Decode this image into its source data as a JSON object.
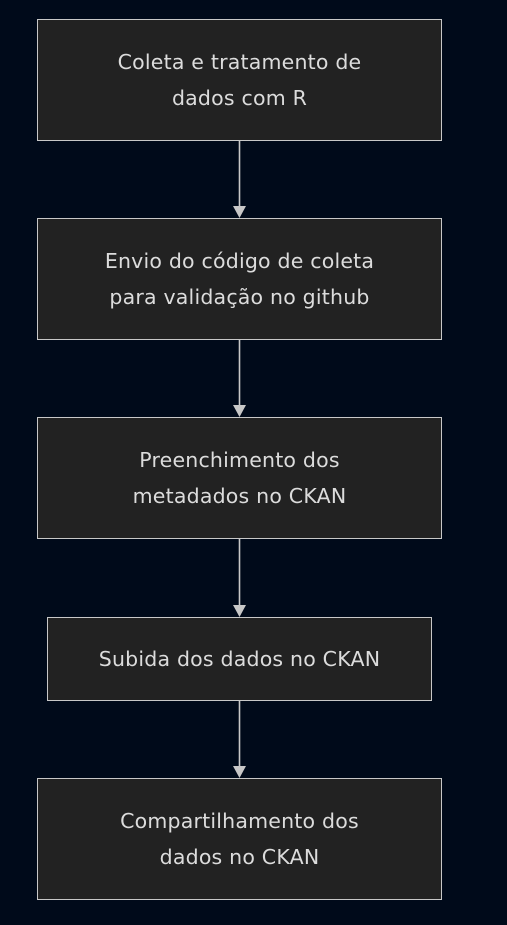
{
  "flowchart": {
    "nodes": [
      {
        "id": "n1",
        "lines": [
          "Coleta e tratamento de",
          "dados com R"
        ]
      },
      {
        "id": "n2",
        "lines": [
          "Envio do código de coleta",
          "para validação no github"
        ]
      },
      {
        "id": "n3",
        "lines": [
          "Preenchimento dos",
          "metadados no CKAN"
        ]
      },
      {
        "id": "n4",
        "lines": [
          "Subida dos dados no CKAN"
        ]
      },
      {
        "id": "n5",
        "lines": [
          "Compartilhamento dos",
          "dados no CKAN"
        ]
      }
    ],
    "edges": [
      {
        "from": "n1",
        "to": "n2"
      },
      {
        "from": "n2",
        "to": "n3"
      },
      {
        "from": "n3",
        "to": "n4"
      },
      {
        "from": "n4",
        "to": "n5"
      }
    ]
  },
  "colors": {
    "background": "#000a1a",
    "node_fill": "#222222",
    "node_border": "#c8c8c8",
    "text": "#dcdcdc",
    "edge": "#c8c8c8"
  }
}
